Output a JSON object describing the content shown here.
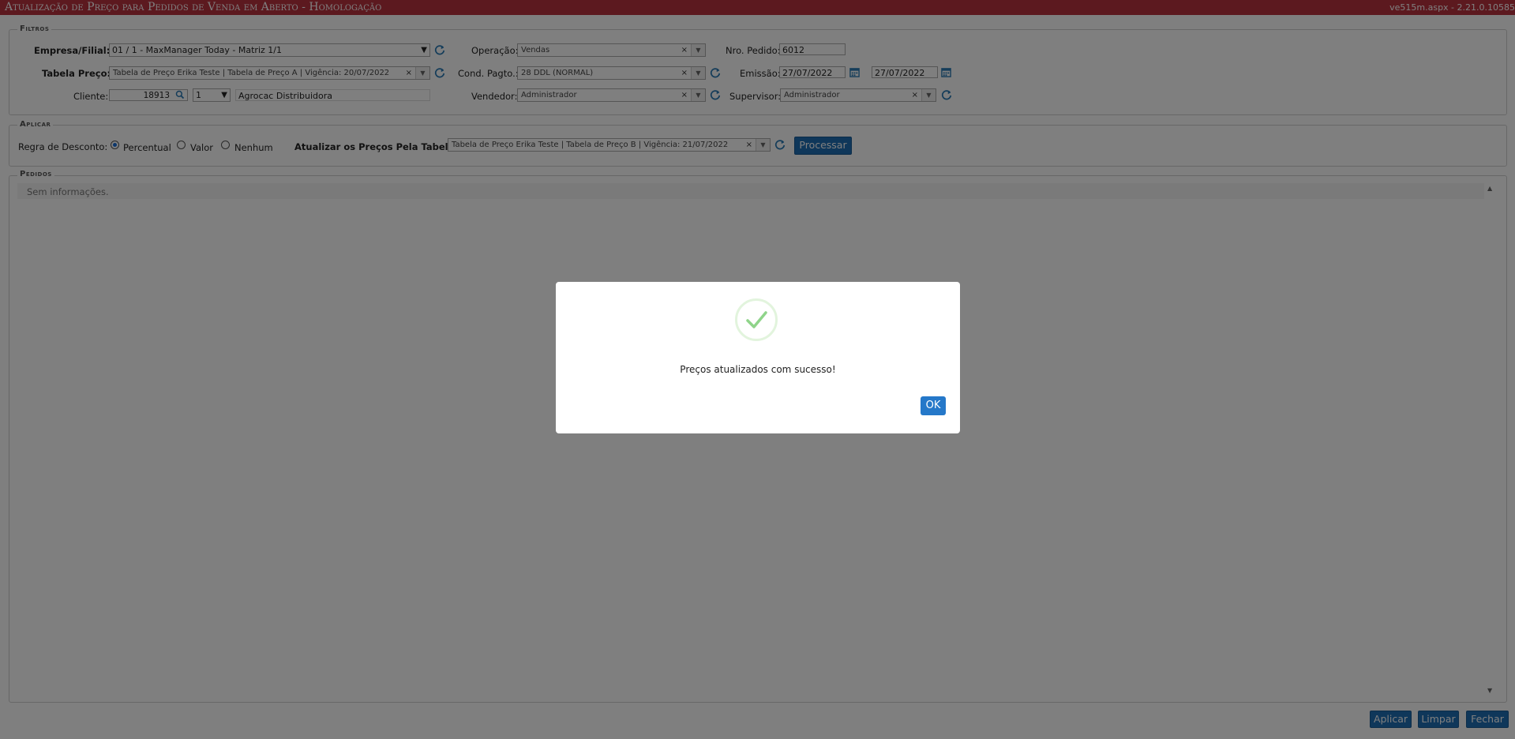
{
  "window": {
    "title": "Atualização de Preço para Pedidos de Venda em Aberto  - Homologação",
    "version": "ve515m.aspx - 2.21.0.10585"
  },
  "filtros": {
    "legend": "Filtros",
    "empresa_label": "Empresa/Filial:",
    "empresa_value": "01 / 1 - MaxManager Today - Matriz 1/1",
    "tabela_label": "Tabela Preço:",
    "tabela_value": "Tabela de Preço Erika Teste | Tabela de Preço A | Vigência: 20/07/2022",
    "cliente_label": "Cliente:",
    "cliente_code": "18913",
    "cliente_seq": "1",
    "cliente_name": "Agrocac Distribuidora",
    "operacao_label": "Operação:",
    "operacao_value": "Vendas",
    "cond_label": "Cond. Pagto.:",
    "cond_value": "28 DDL (NORMAL)",
    "vendedor_label": "Vendedor:",
    "vendedor_value": "Administrador",
    "pedido_label": "Nro. Pedido:",
    "pedido_value": "6012",
    "emissao_label": "Emissão:",
    "emissao_de": "27/07/2022",
    "emissao_ate": "27/07/2022",
    "supervisor_label": "Supervisor:",
    "supervisor_value": "Administrador"
  },
  "aplicar": {
    "legend": "Aplicar",
    "regra_label": "Regra de Desconto:",
    "opt_percentual": "Percentual",
    "opt_valor": "Valor",
    "opt_nenhum": "Nenhum",
    "atualizar_label": "Atualizar os Preços Pela Tabela:",
    "atualizar_value": "Tabela de Preço Erika Teste | Tabela de Preço B | Vigência: 21/07/2022",
    "processar_label": "Processar"
  },
  "pedidos": {
    "legend": "Pedidos",
    "empty_text": "Sem informações."
  },
  "footer": {
    "aplicar_label": "Aplicar",
    "limpar_label": "Limpar",
    "fechar_label": "Fechar"
  },
  "modal": {
    "message": "Preços atualizados com sucesso!",
    "ok_label": "OK"
  },
  "colors": {
    "title_bar": "#b8323f",
    "button_blue": "#1f6fb5",
    "success_green": "#8fd48a"
  },
  "icons": [
    "refresh-icon",
    "search-icon",
    "calendar-icon",
    "check-icon"
  ]
}
